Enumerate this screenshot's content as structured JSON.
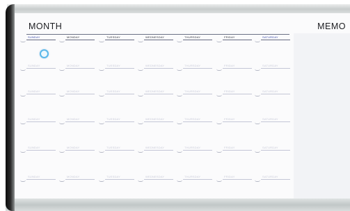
{
  "calendar": {
    "title": "MONTH",
    "memo_title": "MEMO",
    "days": [
      "SUNDAY",
      "MONDAY",
      "TUESDAY",
      "WEDNESDAY",
      "THURSDAY",
      "FRIDAY",
      "SATURDAY"
    ],
    "week_rows": 5
  },
  "colors": {
    "frame": "#1a1a1a",
    "weekend_header": "#3b4aa8",
    "magnet": "#5bb8ea",
    "memo_panel": "#f2f3f6"
  }
}
